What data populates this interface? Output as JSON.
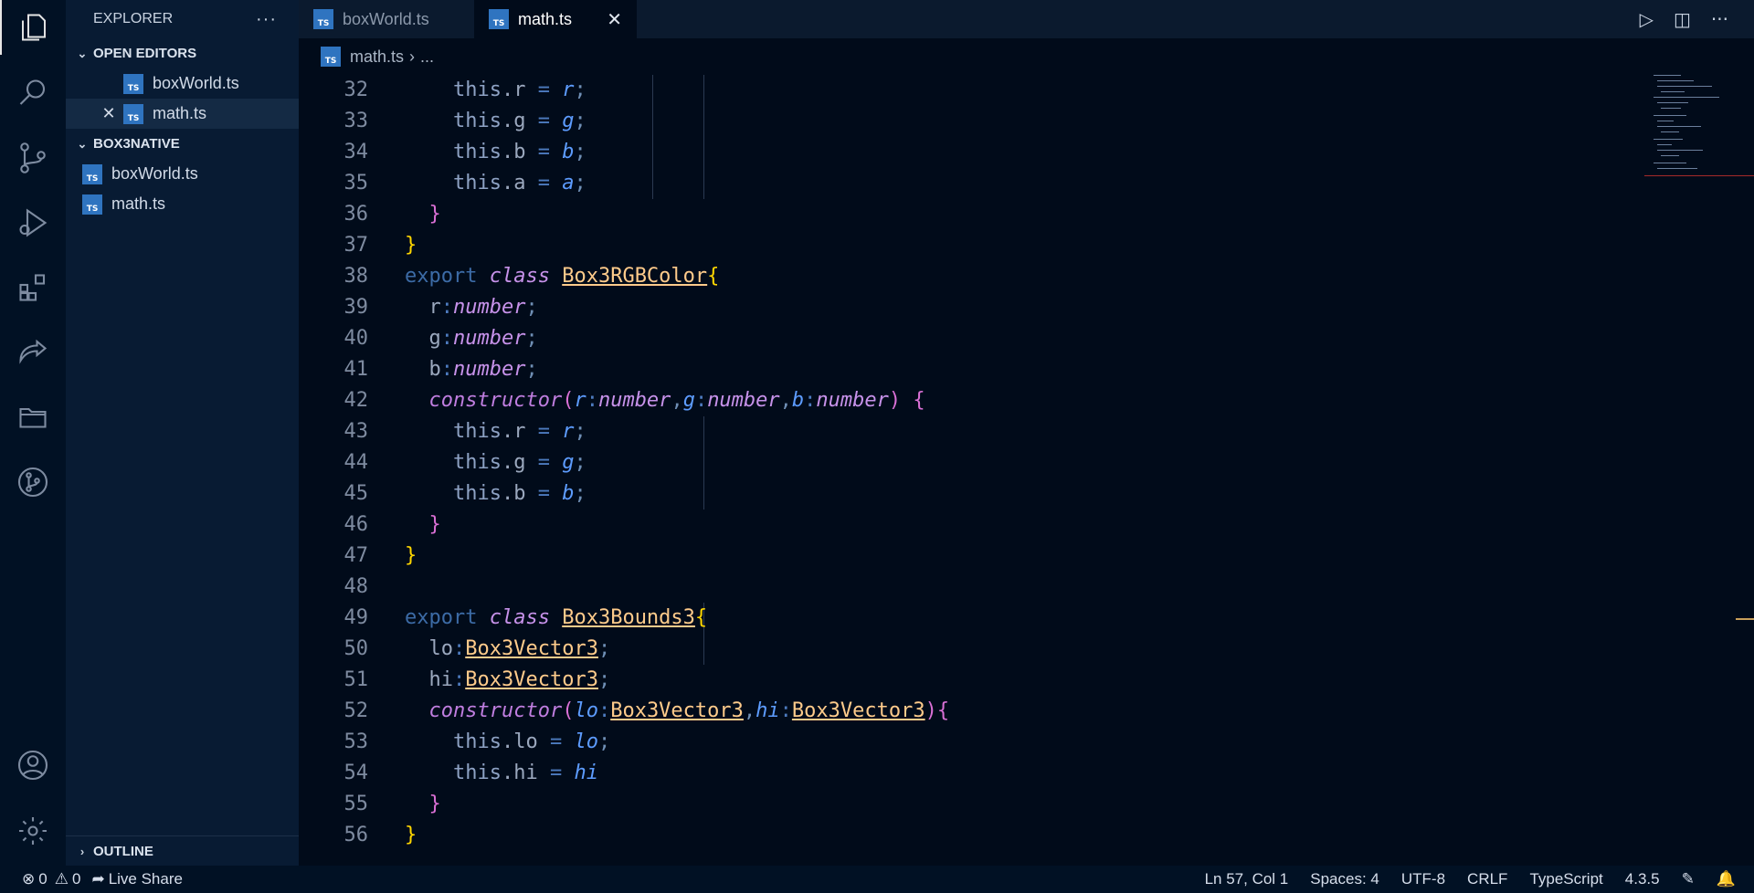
{
  "sidebar": {
    "title": "EXPLORER",
    "more": "···",
    "open_editors_title": "OPEN EDITORS",
    "open_editors": [
      {
        "name": "boxWorld.ts"
      },
      {
        "name": "math.ts"
      }
    ],
    "folder_title": "BOX3NATIVE",
    "files": [
      {
        "name": "boxWorld.ts"
      },
      {
        "name": "math.ts"
      }
    ],
    "outline_title": "OUTLINE",
    "ts_badge": "TS"
  },
  "tabs": [
    {
      "label": "boxWorld.ts"
    },
    {
      "label": "math.ts",
      "close": "✕"
    }
  ],
  "breadcrumb": {
    "file": "math.ts",
    "sep": "›",
    "rest": "..."
  },
  "editor": {
    "line_numbers": [
      "32",
      "33",
      "34",
      "35",
      "36",
      "37",
      "38",
      "39",
      "40",
      "41",
      "42",
      "43",
      "44",
      "45",
      "46",
      "47",
      "48",
      "49",
      "50",
      "51",
      "52",
      "53",
      "54",
      "55",
      "56"
    ]
  },
  "status": {
    "errors": "0",
    "warnings": "0",
    "live_share": "Live Share",
    "position": "Ln 57, Col 1",
    "spaces": "Spaces: 4",
    "encoding": "UTF-8",
    "eol": "CRLF",
    "language": "TypeScript",
    "version": "4.3.5"
  },
  "colors": {
    "background": "#010b1a",
    "sidebar": "#081b33",
    "activity_bar": "#011124",
    "ts_icon": "#2f74c0"
  }
}
